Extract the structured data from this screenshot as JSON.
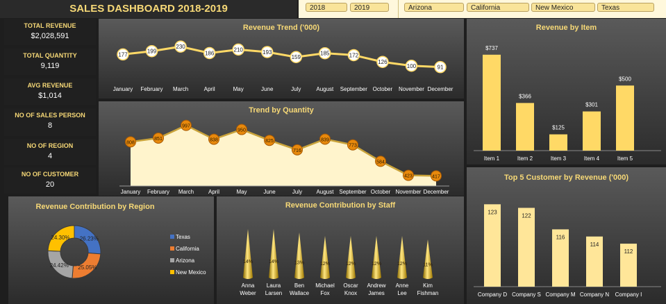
{
  "dashboard": {
    "title": "SALES DASHBOARD 2018-2019"
  },
  "slicers": {
    "years": [
      "2018",
      "2019"
    ],
    "regions": [
      "Arizona",
      "California",
      "New Mexico",
      "Texas"
    ]
  },
  "kpis": [
    {
      "label": "TOTAL REVENUE",
      "value": "$2,028,591"
    },
    {
      "label": "TOTAL QUANTITY",
      "value": "9,119"
    },
    {
      "label": "AVG REVENUE",
      "value": "$1,014"
    },
    {
      "label": "NO OF SALES PERSON",
      "value": "8"
    },
    {
      "label": "NO OF REGION",
      "value": "4"
    },
    {
      "label": "NO OF CUSTOMER",
      "value": "20"
    }
  ],
  "colors": {
    "gold": "#f7d977",
    "bar": "#ffd966",
    "bar_light": "#ffe699",
    "donut_texas": "#4472c4",
    "donut_california": "#ed7d31",
    "donut_arizona": "#a5a5a5",
    "donut_newmexico": "#ffc000",
    "quantity_marker": "#e8890c"
  },
  "chart_data": [
    {
      "id": "revenue_trend",
      "type": "line",
      "title": "Revenue Trend ('000)",
      "categories": [
        "January",
        "February",
        "March",
        "April",
        "May",
        "June",
        "July",
        "August",
        "September",
        "October",
        "November",
        "December"
      ],
      "values": [
        177,
        199,
        230,
        186,
        210,
        193,
        159,
        185,
        172,
        126,
        100,
        91
      ],
      "ylim": [
        80,
        240
      ]
    },
    {
      "id": "trend_quantity",
      "type": "area",
      "title": "Trend by Quantity",
      "categories": [
        "January",
        "February",
        "March",
        "April",
        "May",
        "June",
        "July",
        "August",
        "September",
        "October",
        "November",
        "December"
      ],
      "values": [
        808,
        851,
        997,
        838,
        950,
        825,
        716,
        839,
        773,
        584,
        423,
        417
      ],
      "ylim": [
        300,
        1050
      ]
    },
    {
      "id": "revenue_by_item",
      "type": "bar",
      "title": "Revenue by Item",
      "categories": [
        "Item 1",
        "Item 2",
        "Item 3",
        "Item 4",
        "Item 5"
      ],
      "values": [
        737,
        366,
        125,
        301,
        500
      ],
      "value_labels": [
        "$737",
        "$366",
        "$125",
        "$301",
        "$500"
      ],
      "ylim": [
        0,
        800
      ]
    },
    {
      "id": "top_customers",
      "type": "bar",
      "title": "Top 5 Customer by Revenue ('000)",
      "categories": [
        "Company D",
        "Company S",
        "Company M",
        "Company N",
        "Company I"
      ],
      "values": [
        123,
        122,
        116,
        114,
        112
      ],
      "value_labels": [
        "123",
        "122",
        "116",
        "114",
        "112"
      ],
      "ylim": [
        100,
        125
      ]
    },
    {
      "id": "region_contribution",
      "type": "pie",
      "title": "Revenue Contribution by Region",
      "labels": [
        "Texas",
        "California",
        "Arizona",
        "New Mexico"
      ],
      "values": [
        26.23,
        25.05,
        24.42,
        24.3
      ],
      "value_labels": [
        "26.23%",
        "25.05%",
        "24.42%",
        "24.30%"
      ]
    },
    {
      "id": "staff_contribution",
      "type": "bar",
      "title": "Revenue Contribution by Staff",
      "categories": [
        "Anna Weber",
        "Laura Larsen",
        "Ben Wallace",
        "Michael Fox",
        "Oscar Knox",
        "Andrew James",
        "Anne Lee",
        "Kim Fishman"
      ],
      "category_lines": [
        [
          "Anna",
          "Weber"
        ],
        [
          "Laura",
          "Larsen"
        ],
        [
          "Ben",
          "Wallace"
        ],
        [
          "Michael",
          "Fox"
        ],
        [
          "Oscar",
          "Knox"
        ],
        [
          "Andrew",
          "James"
        ],
        [
          "Anne",
          "Lee"
        ],
        [
          "Kim",
          "Fishman"
        ]
      ],
      "values": [
        14,
        14,
        13,
        12,
        12,
        12,
        12,
        11
      ],
      "value_labels": [
        "14%",
        "14%",
        "13%",
        "12%",
        "12%",
        "12%",
        "12%",
        "11%"
      ],
      "ylim": [
        0,
        15
      ]
    }
  ]
}
